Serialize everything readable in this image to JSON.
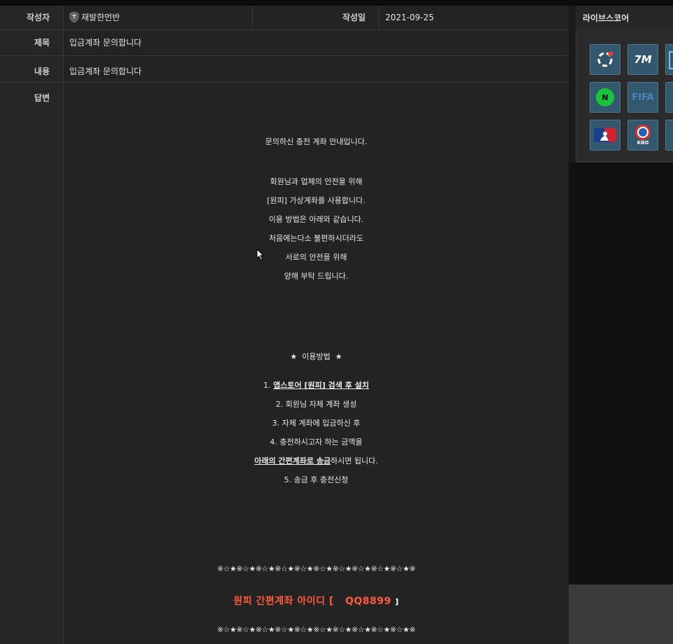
{
  "post": {
    "author_label": "작성자",
    "author": "재발한먼반",
    "date_label": "작성일",
    "date": "2021-09-25",
    "title_label": "제목",
    "title": "입금계좌 문의합니다",
    "content_label": "내용",
    "content": "입금계좌 문의합니다",
    "answer_label": "답변"
  },
  "answer": {
    "intro": "문의하신 충전 계좌 안내입니다.",
    "lines": [
      "회원님과 업체의 안전을 위해",
      "[원피] 가상계좌를 사용합니다.",
      "이용 방법은 아래와 같습니다.",
      "처음에는다소 불편하시더라도",
      "서로의 안전을 위해",
      "양해 부탁 드립니다."
    ],
    "usage_title": "★  이용방법  ★",
    "step1_prefix": "1. ",
    "step1_underline": "앱스토어 [원피] 검색 후 설치",
    "step2": "2. 회원님 자체 계좌 생성",
    "step3": "3. 자체 계좌에 입금하신 후",
    "step4": "4. 충전하시고자 하는 금액을",
    "step4b_underline": "아래의 간편계좌로 송금",
    "step4b_suffix": "하시면 됩니다.",
    "step5": "5. 송금 후 충전신청",
    "stars_line": "※☆★※☆★※☆★※☆★※☆★※☆★※☆★※☆★※☆★※☆★※",
    "account_text": "원피 간편계좌 아이디 [",
    "account_id": "QQ8899",
    "account_close": "]"
  },
  "sidebar": {
    "title": "라이브스코어",
    "tiles": [
      {
        "icon": "livescore-ring-icon"
      },
      {
        "icon": "7m-icon",
        "text": "7M"
      },
      {
        "icon": "partial-icon"
      },
      {
        "icon": "naver-icon",
        "text": "N"
      },
      {
        "icon": "fifa-icon",
        "text": "FIFA"
      },
      {
        "icon": "partial-icon"
      },
      {
        "icon": "mlb-icon"
      },
      {
        "icon": "kbo-icon",
        "text": "KBO"
      },
      {
        "icon": "partial-icon"
      }
    ]
  },
  "colors": {
    "background": "#1b1b1b",
    "panel": "#232323",
    "accent_red": "#ff5b3a",
    "tile": "#33586e"
  }
}
